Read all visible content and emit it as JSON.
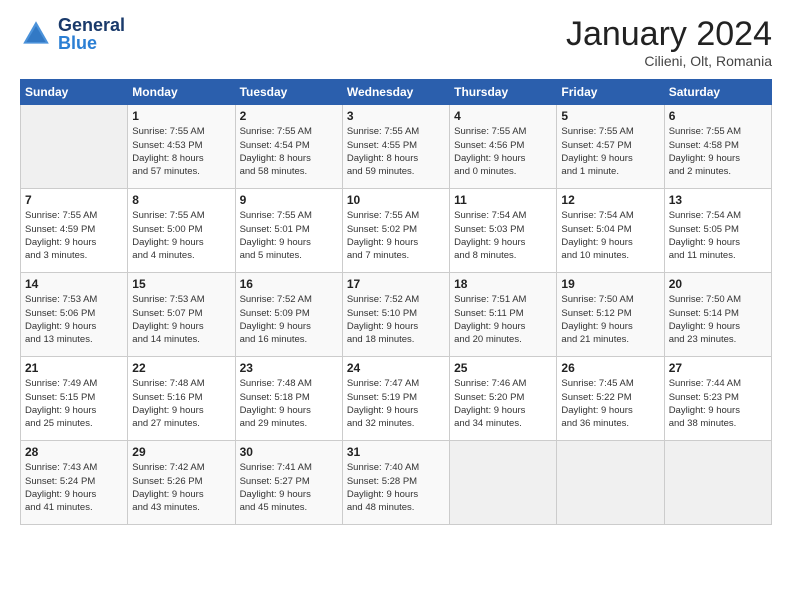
{
  "logo": {
    "text_general": "General",
    "text_blue": "Blue"
  },
  "title": "January 2024",
  "location": "Cilieni, Olt, Romania",
  "days_header": [
    "Sunday",
    "Monday",
    "Tuesday",
    "Wednesday",
    "Thursday",
    "Friday",
    "Saturday"
  ],
  "weeks": [
    [
      {
        "day": "",
        "info": ""
      },
      {
        "day": "1",
        "info": "Sunrise: 7:55 AM\nSunset: 4:53 PM\nDaylight: 8 hours\nand 57 minutes."
      },
      {
        "day": "2",
        "info": "Sunrise: 7:55 AM\nSunset: 4:54 PM\nDaylight: 8 hours\nand 58 minutes."
      },
      {
        "day": "3",
        "info": "Sunrise: 7:55 AM\nSunset: 4:55 PM\nDaylight: 8 hours\nand 59 minutes."
      },
      {
        "day": "4",
        "info": "Sunrise: 7:55 AM\nSunset: 4:56 PM\nDaylight: 9 hours\nand 0 minutes."
      },
      {
        "day": "5",
        "info": "Sunrise: 7:55 AM\nSunset: 4:57 PM\nDaylight: 9 hours\nand 1 minute."
      },
      {
        "day": "6",
        "info": "Sunrise: 7:55 AM\nSunset: 4:58 PM\nDaylight: 9 hours\nand 2 minutes."
      }
    ],
    [
      {
        "day": "7",
        "info": "Sunrise: 7:55 AM\nSunset: 4:59 PM\nDaylight: 9 hours\nand 3 minutes."
      },
      {
        "day": "8",
        "info": "Sunrise: 7:55 AM\nSunset: 5:00 PM\nDaylight: 9 hours\nand 4 minutes."
      },
      {
        "day": "9",
        "info": "Sunrise: 7:55 AM\nSunset: 5:01 PM\nDaylight: 9 hours\nand 5 minutes."
      },
      {
        "day": "10",
        "info": "Sunrise: 7:55 AM\nSunset: 5:02 PM\nDaylight: 9 hours\nand 7 minutes."
      },
      {
        "day": "11",
        "info": "Sunrise: 7:54 AM\nSunset: 5:03 PM\nDaylight: 9 hours\nand 8 minutes."
      },
      {
        "day": "12",
        "info": "Sunrise: 7:54 AM\nSunset: 5:04 PM\nDaylight: 9 hours\nand 10 minutes."
      },
      {
        "day": "13",
        "info": "Sunrise: 7:54 AM\nSunset: 5:05 PM\nDaylight: 9 hours\nand 11 minutes."
      }
    ],
    [
      {
        "day": "14",
        "info": "Sunrise: 7:53 AM\nSunset: 5:06 PM\nDaylight: 9 hours\nand 13 minutes."
      },
      {
        "day": "15",
        "info": "Sunrise: 7:53 AM\nSunset: 5:07 PM\nDaylight: 9 hours\nand 14 minutes."
      },
      {
        "day": "16",
        "info": "Sunrise: 7:52 AM\nSunset: 5:09 PM\nDaylight: 9 hours\nand 16 minutes."
      },
      {
        "day": "17",
        "info": "Sunrise: 7:52 AM\nSunset: 5:10 PM\nDaylight: 9 hours\nand 18 minutes."
      },
      {
        "day": "18",
        "info": "Sunrise: 7:51 AM\nSunset: 5:11 PM\nDaylight: 9 hours\nand 20 minutes."
      },
      {
        "day": "19",
        "info": "Sunrise: 7:50 AM\nSunset: 5:12 PM\nDaylight: 9 hours\nand 21 minutes."
      },
      {
        "day": "20",
        "info": "Sunrise: 7:50 AM\nSunset: 5:14 PM\nDaylight: 9 hours\nand 23 minutes."
      }
    ],
    [
      {
        "day": "21",
        "info": "Sunrise: 7:49 AM\nSunset: 5:15 PM\nDaylight: 9 hours\nand 25 minutes."
      },
      {
        "day": "22",
        "info": "Sunrise: 7:48 AM\nSunset: 5:16 PM\nDaylight: 9 hours\nand 27 minutes."
      },
      {
        "day": "23",
        "info": "Sunrise: 7:48 AM\nSunset: 5:18 PM\nDaylight: 9 hours\nand 29 minutes."
      },
      {
        "day": "24",
        "info": "Sunrise: 7:47 AM\nSunset: 5:19 PM\nDaylight: 9 hours\nand 32 minutes."
      },
      {
        "day": "25",
        "info": "Sunrise: 7:46 AM\nSunset: 5:20 PM\nDaylight: 9 hours\nand 34 minutes."
      },
      {
        "day": "26",
        "info": "Sunrise: 7:45 AM\nSunset: 5:22 PM\nDaylight: 9 hours\nand 36 minutes."
      },
      {
        "day": "27",
        "info": "Sunrise: 7:44 AM\nSunset: 5:23 PM\nDaylight: 9 hours\nand 38 minutes."
      }
    ],
    [
      {
        "day": "28",
        "info": "Sunrise: 7:43 AM\nSunset: 5:24 PM\nDaylight: 9 hours\nand 41 minutes."
      },
      {
        "day": "29",
        "info": "Sunrise: 7:42 AM\nSunset: 5:26 PM\nDaylight: 9 hours\nand 43 minutes."
      },
      {
        "day": "30",
        "info": "Sunrise: 7:41 AM\nSunset: 5:27 PM\nDaylight: 9 hours\nand 45 minutes."
      },
      {
        "day": "31",
        "info": "Sunrise: 7:40 AM\nSunset: 5:28 PM\nDaylight: 9 hours\nand 48 minutes."
      },
      {
        "day": "",
        "info": ""
      },
      {
        "day": "",
        "info": ""
      },
      {
        "day": "",
        "info": ""
      }
    ]
  ]
}
